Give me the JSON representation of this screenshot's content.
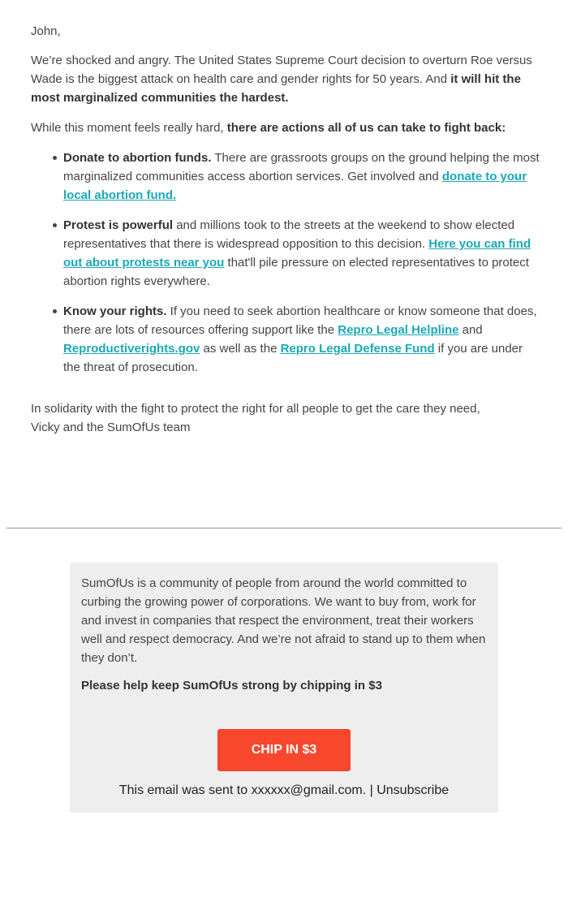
{
  "email": {
    "greeting": "John,",
    "intro": {
      "text": "We’re shocked and angry. The United States Supreme Court decision to overturn Roe versus Wade is the biggest attack on health care and gender rights for 50 years. And ",
      "bold": "it will hit the most marginalized communities the hardest."
    },
    "call": {
      "text": "While this moment feels really hard, ",
      "bold": "there are actions all of us can take to fight back:"
    },
    "actions": [
      {
        "bold": "Donate to abortion funds.",
        "text": " There are grassroots groups on the ground helping the most marginalized communities access abortion services. Get involved and ",
        "link": "donate to your local abortion fund."
      },
      {
        "bold": "Protest is powerful",
        "text": " and millions took to the streets at the weekend to show elected representatives that there is widespread opposition to this decision. ",
        "link": "Here you can find out about protests near you",
        "text_after": " that'll pile pressure on elected representatives to protect abortion rights everywhere."
      },
      {
        "bold": "Know your rights.",
        "text": " If you need to seek abortion healthcare or know someone that does, there are lots of resources offering support like the ",
        "link1": "Repro Legal Helpline",
        "text2": " and ",
        "link2": "Reproductiverights.gov",
        "text3": " as well as the ",
        "link3": "Repro Legal Defense Fund",
        "text4": " if you are under the threat of prosecution."
      }
    ],
    "signoff_line1": "In solidarity with the fight to protect the right for all people to get the care they need,",
    "signoff_line2": "Vicky and the SumOfUs team"
  },
  "footer": {
    "about": "SumOfUs is a community of people from around the world committed to curbing the growing power of corporations. We want to buy from, work for and invest in companies that respect the environment, treat their workers well and respect democracy. And we’re not afraid to stand up to them when they don’t.",
    "ask": "Please help keep SumOfUs strong by chipping in $3",
    "button_label": "CHIP IN $3",
    "sent_to": "This email was sent to xxxxxx@gmail.com. | ",
    "unsubscribe": "Unsubscribe"
  },
  "colors": {
    "link": "#1ba8b6",
    "button": "#f9472d",
    "footer_bg": "#eeeeee"
  }
}
